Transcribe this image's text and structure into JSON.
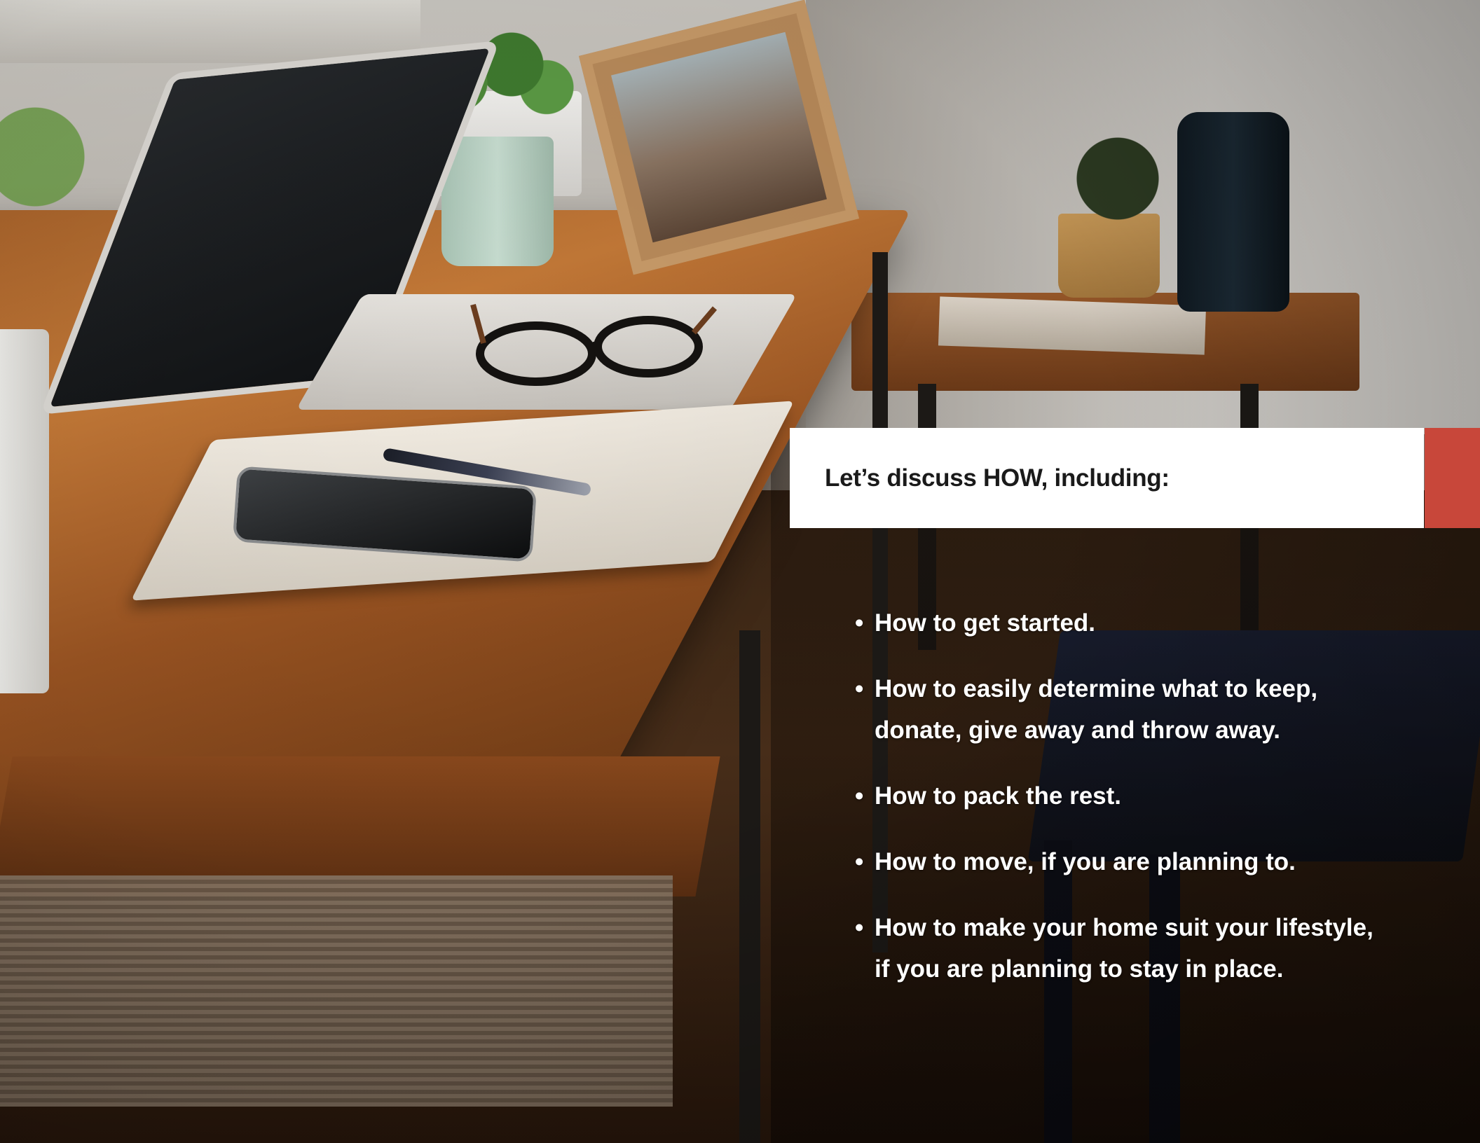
{
  "colors": {
    "accent": "#c8473a",
    "heading_bg": "#ffffff",
    "heading_text": "#1a1a1a",
    "body_text": "#ffffff"
  },
  "heading": "Let’s discuss HOW, including:",
  "bullet_glyph": "•",
  "bullets": [
    {
      "lines": [
        "How to get started."
      ]
    },
    {
      "lines": [
        "How to easily determine what to keep,",
        "donate, give away and throw away."
      ]
    },
    {
      "lines": [
        "How to pack the rest."
      ]
    },
    {
      "lines": [
        "How to move, if you are planning to."
      ]
    },
    {
      "lines": [
        "How to make your home suit your lifestyle,",
        "if you are planning to stay in place."
      ]
    }
  ]
}
